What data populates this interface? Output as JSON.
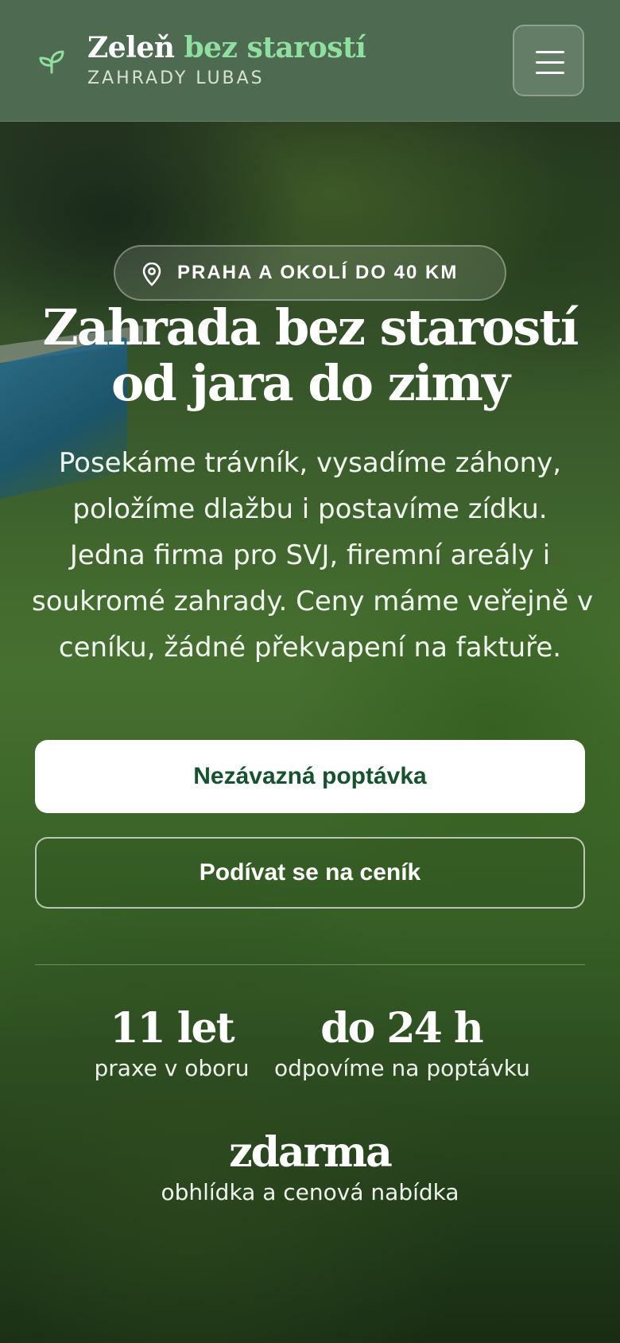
{
  "header": {
    "brand_title_part1": "Zeleň ",
    "brand_title_accent": "bez starostí",
    "brand_subtitle": "ZAHRADY LUBAS",
    "logo_icon": "sprout-icon",
    "menu_icon": "hamburger-menu-icon"
  },
  "hero": {
    "badge_icon": "map-pin-icon",
    "badge_text": "PRAHA A OKOLÍ DO 40 KM",
    "title_lines": [
      "Zahrada bez starostí",
      "od jara do zimy"
    ],
    "description_lines": [
      "Posekáme trávník, vysadíme záhony,",
      "položíme dlažbu i postavíme zídku.",
      "Jedna firma pro SVJ, firemní areály i",
      "soukromé zahrady. Ceny máme veřejně v",
      "ceníku, žádné překvapení na faktuře."
    ],
    "primary_button": "Nezávazná poptávka",
    "secondary_button": "Podívat se na ceník",
    "stats": [
      {
        "value": "11 let",
        "label": "praxe v oboru"
      },
      {
        "value": "do 24 h",
        "label": "odpovíme na poptávku"
      },
      {
        "value": "zdarma",
        "label": "obhlídka a cenová nabídka"
      }
    ]
  },
  "colors": {
    "header_bg": "#4e6b51",
    "accent_green": "#8fe0a0",
    "primary_button_text": "#14532d",
    "text_white": "#ffffff"
  }
}
